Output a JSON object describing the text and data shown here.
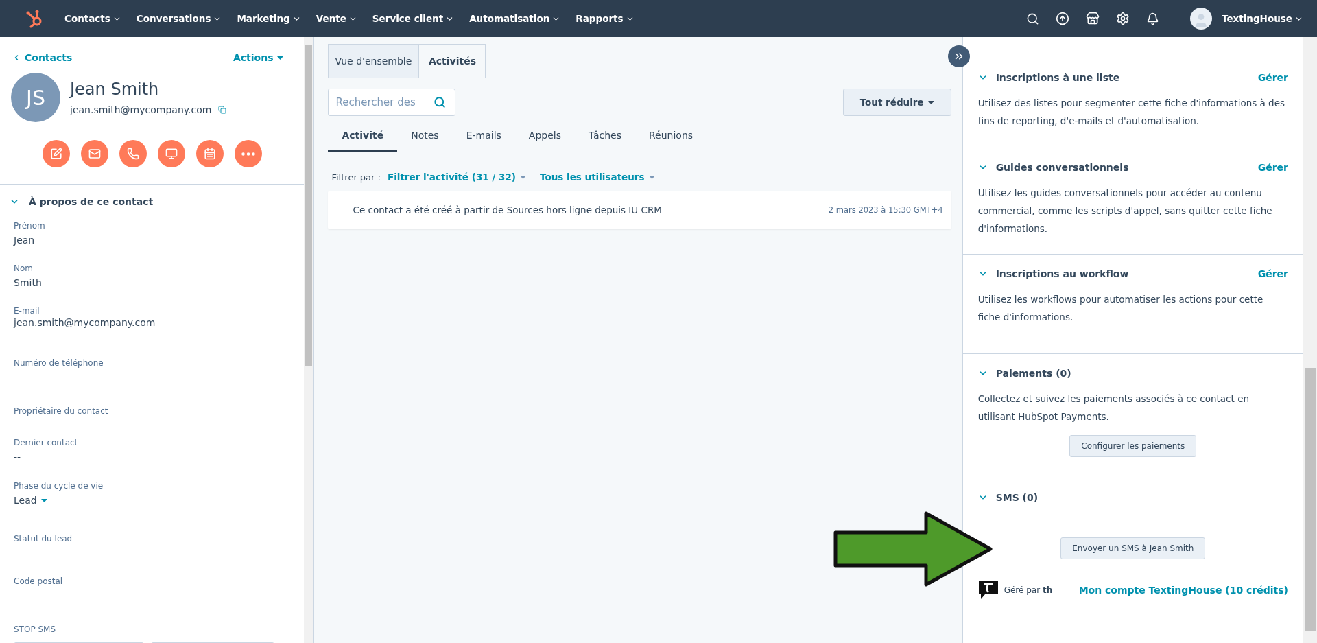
{
  "nav": {
    "menus": [
      {
        "label": "Contacts"
      },
      {
        "label": "Conversations"
      },
      {
        "label": "Marketing"
      },
      {
        "label": "Vente"
      },
      {
        "label": "Service client"
      },
      {
        "label": "Automatisation"
      },
      {
        "label": "Rapports"
      }
    ],
    "account": "TextingHouse"
  },
  "contact": {
    "back": "Contacts",
    "actions": "Actions",
    "initials": "JS",
    "name": "Jean Smith",
    "email": "jean.smith@mycompany.com"
  },
  "about": {
    "title": "À propos de ce contact",
    "expanded": true,
    "fields": [
      {
        "label": "Prénom",
        "value": "Jean"
      },
      {
        "label": "Nom",
        "value": "Smith"
      },
      {
        "label": "E-mail",
        "value": "jean.smith@mycompany.com"
      },
      {
        "label": "Numéro de téléphone"
      },
      {
        "label": "Propriétaire du contact"
      },
      {
        "label": "Dernier contact",
        "value": "--"
      },
      {
        "label": "Phase du cycle de vie",
        "value": "Lead",
        "kind": "dropdown"
      },
      {
        "label": "Statut du lead"
      },
      {
        "label": "Code postal"
      },
      {
        "label": "STOP SMS",
        "kind": "buttons"
      }
    ]
  },
  "record_tabs": [
    {
      "label": "Vue d'ensemble",
      "selected": false
    },
    {
      "label": "Activités",
      "selected": true
    }
  ],
  "search": {
    "placeholder": "Rechercher des"
  },
  "collapse_button": "Tout réduire",
  "activity_tabs": [
    {
      "label": "Activité",
      "selected": true
    },
    {
      "label": "Notes",
      "selected": false
    },
    {
      "label": "E-mails",
      "selected": false
    },
    {
      "label": "Appels",
      "selected": false
    },
    {
      "label": "Tâches",
      "selected": false
    },
    {
      "label": "Réunions",
      "selected": false
    }
  ],
  "filter": {
    "label": "Filtrer par :",
    "activity": "Filtrer l'activité (31 / 32)",
    "users": "Tous les utilisateurs"
  },
  "activities": [
    {
      "text": "Ce contact a été créé à partir de Sources hors ligne depuis IU CRM",
      "time": "2 mars 2023 à 15:30 GMT+4"
    }
  ],
  "sidebar_sections": [
    {
      "title": "Inscriptions à une liste",
      "action": "Gérer",
      "expanded": true,
      "description": "Utilisez des listes pour segmenter cette fiche d'informations à des fins de reporting, d'e-mails et d'automatisation."
    },
    {
      "title": "Guides conversationnels",
      "action": "Gérer",
      "expanded": true,
      "description": "Utilisez les guides conversationnels pour accéder au contenu commercial, comme les scripts d'appel, sans quitter cette fiche d'informations."
    },
    {
      "title": "Inscriptions au workflow",
      "action": "Gérer",
      "expanded": true,
      "description": "Utilisez les workflows pour automatiser les actions pour cette fiche d'informations."
    },
    {
      "title": "Paiements (0)",
      "expanded": true,
      "description": "Collectez et suivez les paiements associés à ce contact en utilisant HubSpot Payments.",
      "button": "Configurer les paiements"
    },
    {
      "title": "SMS (0)",
      "expanded": true,
      "button": "Envoyer un SMS à Jean Smith",
      "footer": {
        "managed_by": "Géré par",
        "brand": "th",
        "account_link": "Mon compte TextingHouse (10 crédits)"
      }
    }
  ]
}
